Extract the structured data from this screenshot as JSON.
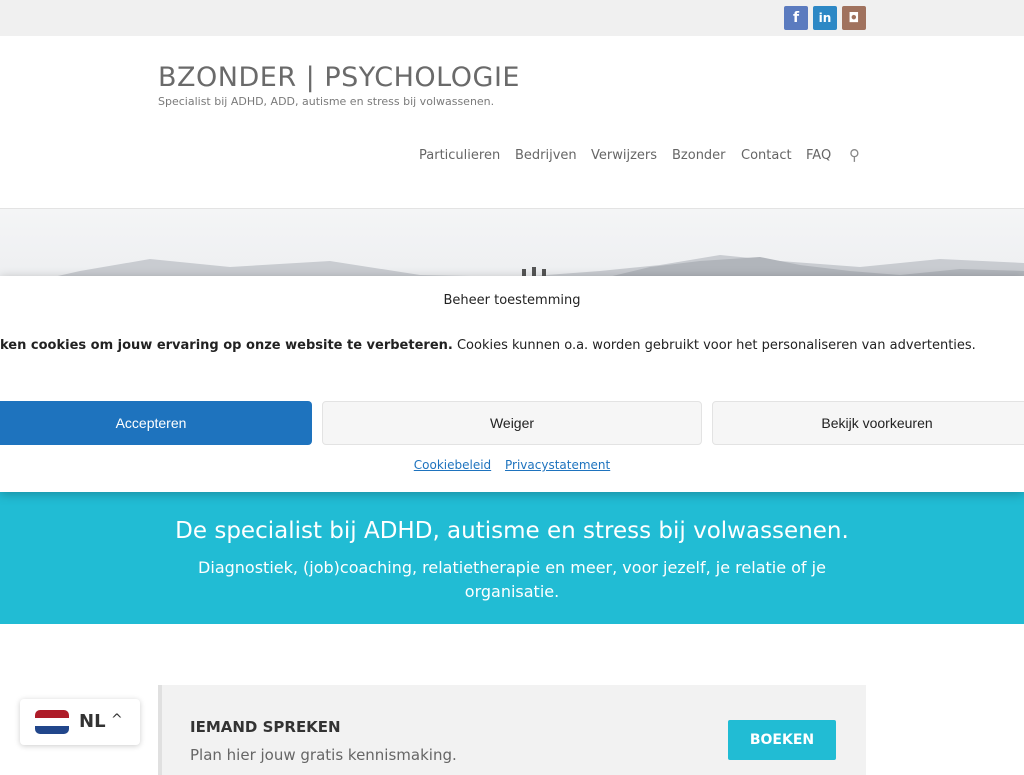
{
  "social": {
    "facebook_glyph": "f",
    "linkedin_glyph": "in",
    "instagram_glyph": "◘",
    "colors": {
      "facebook": "#5b7bbf",
      "linkedin": "#2d88c5",
      "instagram": "#a0725e"
    }
  },
  "header": {
    "title": "BZONDER | PSYCHOLOGIE",
    "subtitle": "Specialist bij ADHD, ADD, autisme en stress bij volwassenen."
  },
  "nav": {
    "items": [
      "Particulieren",
      "Bedrijven",
      "Verwijzers",
      "Bzonder",
      "Contact",
      "FAQ"
    ],
    "search_glyph": "⚲"
  },
  "cookie_modal": {
    "title": "Beheer toestemming",
    "message_bold": "ken cookies om jouw ervaring op onze website te verbeteren.",
    "message_rest": " Cookies kunnen o.a. worden gebruikt voor het personaliseren van advertenties.",
    "accept_label": "Accepteren",
    "deny_label": "Weiger",
    "preferences_label": "Bekijk voorkeuren",
    "cookie_policy_link": "Cookiebeleid",
    "privacy_link": "Privacystatement"
  },
  "banner": {
    "heading": "De specialist bij ADHD, autisme en stress bij volwassenen.",
    "subheading": "Diagnostiek, (job)coaching, relatietherapie en meer, voor jezelf, je relatie of je organisatie."
  },
  "cta": {
    "title": "IEMAND SPREKEN",
    "text": "Plan hier jouw gratis kennismaking.",
    "button_label": "BOEKEN"
  },
  "language": {
    "code": "NL",
    "chevron_glyph": "^"
  },
  "colors": {
    "accent_teal": "#21bcd4",
    "accept_blue": "#1e73be"
  }
}
